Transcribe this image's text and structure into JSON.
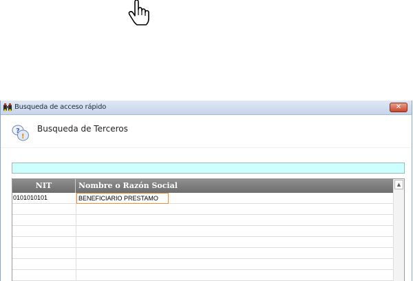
{
  "window": {
    "title": "Busqueda de acceso rápido",
    "close_label": "✕"
  },
  "header": {
    "title": "Busqueda de Terceros"
  },
  "search": {
    "value": ""
  },
  "table": {
    "columns": [
      "NIT",
      "Nombre o Razón Social"
    ],
    "rows": [
      {
        "nit": "0101010101",
        "name": "BENEFICIARIO PRESTAMO"
      },
      {
        "nit": "",
        "name": ""
      },
      {
        "nit": "",
        "name": ""
      },
      {
        "nit": "",
        "name": ""
      },
      {
        "nit": "",
        "name": ""
      },
      {
        "nit": "",
        "name": ""
      },
      {
        "nit": "",
        "name": ""
      },
      {
        "nit": "",
        "name": ""
      }
    ],
    "scroll_up_glyph": "▲"
  },
  "icons": {
    "cursor": "hand-pointer-icon",
    "app": "binoculars-icon",
    "header": "question-balloon-icon"
  }
}
